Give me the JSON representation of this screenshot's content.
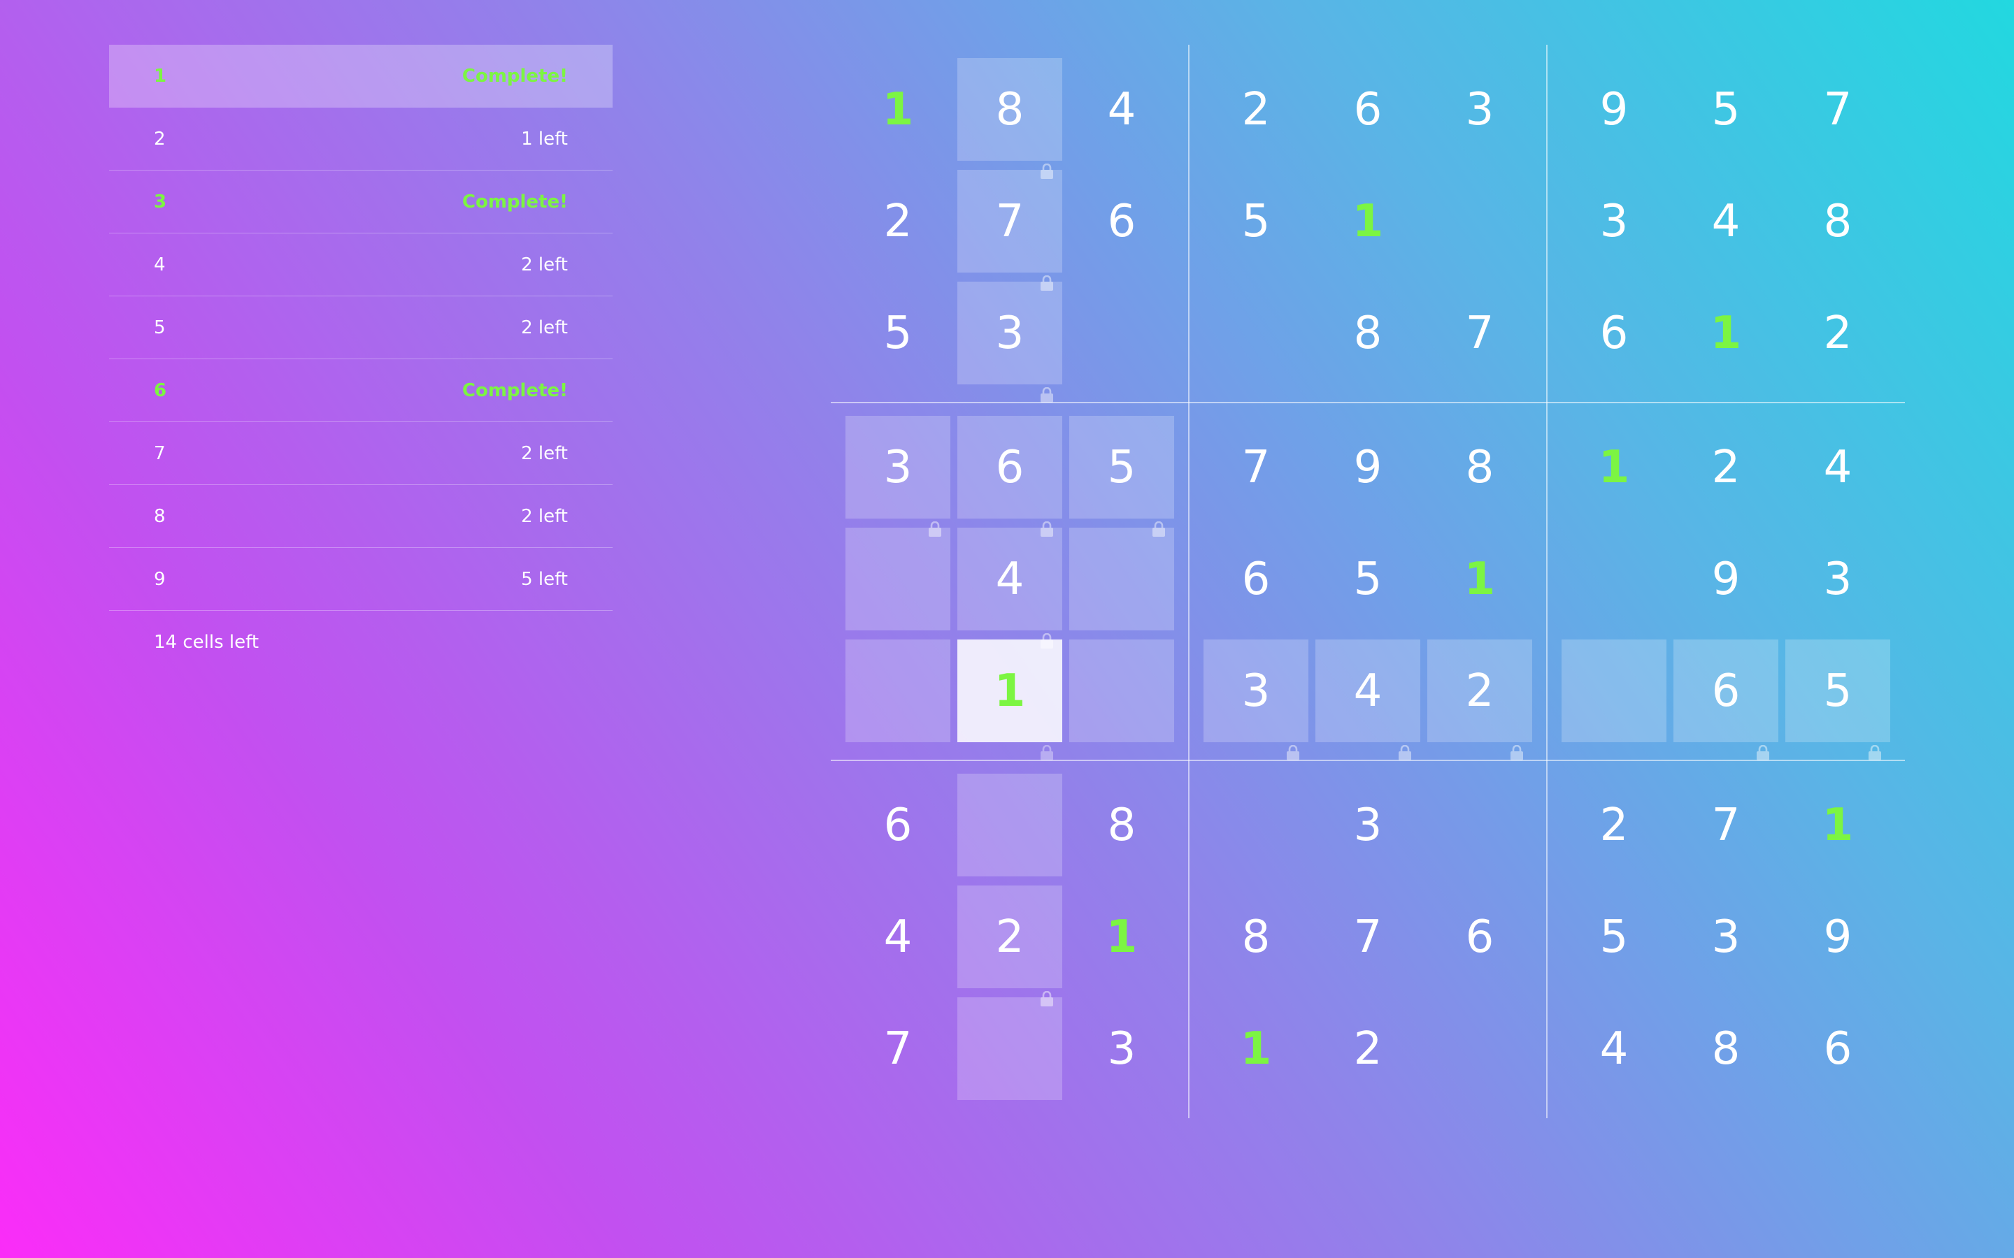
{
  "panel": {
    "digits": [
      {
        "digit": "1",
        "status": "Complete!",
        "complete": true,
        "selected": true
      },
      {
        "digit": "2",
        "status": "1 left",
        "complete": false,
        "selected": false
      },
      {
        "digit": "3",
        "status": "Complete!",
        "complete": true,
        "selected": false
      },
      {
        "digit": "4",
        "status": "2 left",
        "complete": false,
        "selected": false
      },
      {
        "digit": "5",
        "status": "2 left",
        "complete": false,
        "selected": false
      },
      {
        "digit": "6",
        "status": "Complete!",
        "complete": true,
        "selected": false
      },
      {
        "digit": "7",
        "status": "2 left",
        "complete": false,
        "selected": false
      },
      {
        "digit": "8",
        "status": "2 left",
        "complete": false,
        "selected": false
      },
      {
        "digit": "9",
        "status": "5 left",
        "complete": false,
        "selected": false
      }
    ],
    "cells_left": "14 cells left"
  },
  "board": {
    "selected_digit": "1",
    "selected_cell": [
      5,
      1
    ],
    "rows": [
      [
        "1",
        "8",
        "4",
        "2",
        "6",
        "3",
        "9",
        "5",
        "7"
      ],
      [
        "2",
        "7",
        "6",
        "5",
        "1",
        "",
        "3",
        "4",
        "8"
      ],
      [
        "5",
        "3",
        "",
        "",
        "8",
        "7",
        "6",
        "1",
        "2"
      ],
      [
        "3",
        "6",
        "5",
        "7",
        "9",
        "8",
        "1",
        "2",
        "4"
      ],
      [
        "",
        "4",
        "",
        "6",
        "5",
        "1",
        "",
        "9",
        "3"
      ],
      [
        "",
        "1",
        "",
        "3",
        "4",
        "2",
        "",
        "6",
        "5"
      ],
      [
        "6",
        "",
        "8",
        "",
        "3",
        "",
        "2",
        "7",
        "1"
      ],
      [
        "4",
        "2",
        "1",
        "8",
        "7",
        "6",
        "5",
        "3",
        "9"
      ],
      [
        "7",
        "",
        "3",
        "1",
        "2",
        "",
        "4",
        "8",
        "6"
      ]
    ],
    "shaded": [
      [
        0,
        1
      ],
      [
        1,
        1
      ],
      [
        2,
        1
      ],
      [
        3,
        0
      ],
      [
        3,
        1
      ],
      [
        3,
        2
      ],
      [
        4,
        0
      ],
      [
        4,
        1
      ],
      [
        4,
        2
      ],
      [
        5,
        0
      ],
      [
        5,
        1
      ],
      [
        5,
        2
      ],
      [
        5,
        3
      ],
      [
        5,
        4
      ],
      [
        5,
        5
      ],
      [
        5,
        6
      ],
      [
        5,
        7
      ],
      [
        5,
        8
      ],
      [
        6,
        1
      ],
      [
        7,
        1
      ],
      [
        8,
        1
      ]
    ],
    "locked": [
      [
        0,
        1
      ],
      [
        1,
        1
      ],
      [
        2,
        1
      ],
      [
        3,
        0
      ],
      [
        3,
        1
      ],
      [
        3,
        2
      ],
      [
        4,
        1
      ],
      [
        5,
        1
      ],
      [
        5,
        3
      ],
      [
        5,
        4
      ],
      [
        5,
        5
      ],
      [
        5,
        7
      ],
      [
        5,
        8
      ],
      [
        7,
        1
      ]
    ]
  },
  "colors": {
    "complete": "#7cf542",
    "text": "#ffffff"
  },
  "icons": {
    "lock": "lock-icon"
  }
}
